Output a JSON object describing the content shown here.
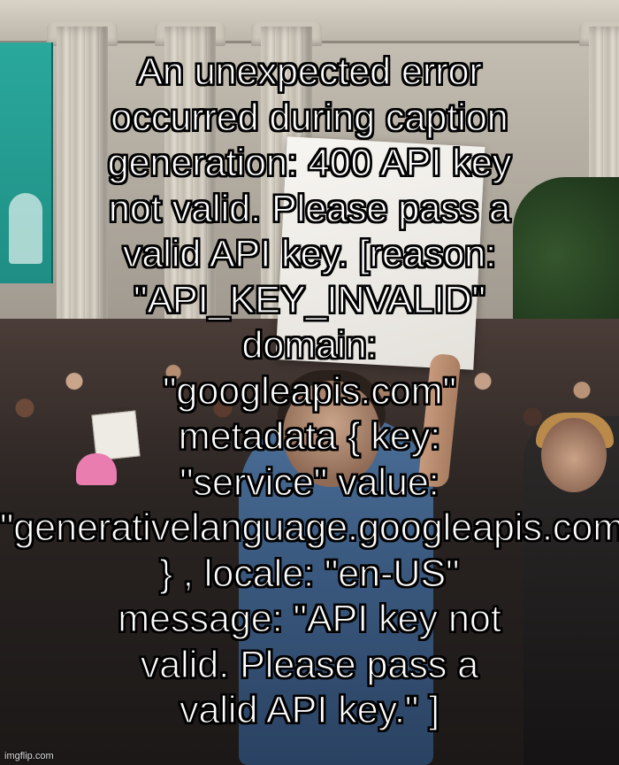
{
  "meme": {
    "caption_lines": [
      "An unexpected error",
      "occurred during caption",
      "generation: 400 API key",
      "not valid. Please pass a",
      "valid API key. [reason:",
      "\"API_KEY_INVALID\"",
      "domain:",
      "\"googleapis.com\"",
      "metadata { key:",
      "\"service\" value:",
      "\"generativelanguage.googleapis.com\"",
      "} , locale: \"en-US\"",
      "message: \"API key not",
      "valid. Please pass a",
      "valid API key.\" ]"
    ],
    "watermark": "imgflip.com",
    "colors": {
      "caption_fill": "#ffffff",
      "caption_outline": "#000000"
    }
  }
}
